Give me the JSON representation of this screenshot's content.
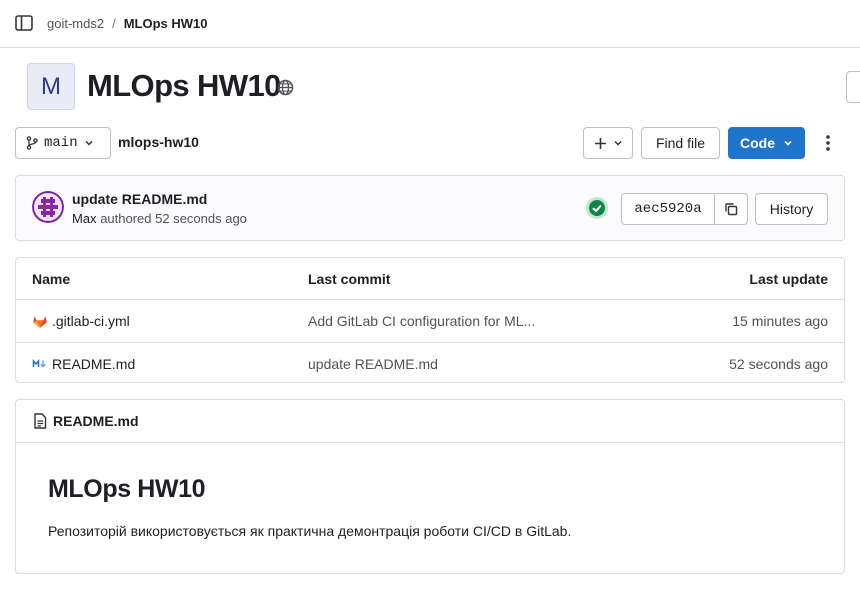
{
  "breadcrumb": {
    "group": "goit-mds2",
    "separator": "/",
    "current": "MLOps HW10"
  },
  "project": {
    "avatar_letter": "M",
    "title": "MLOps HW10",
    "visibility_icon": "globe-icon"
  },
  "toolbar": {
    "branch": "main",
    "path": "mlops-hw10",
    "plus_label": "+",
    "find_file": "Find file",
    "code": "Code"
  },
  "commit": {
    "title": "update README.md",
    "author": "Max",
    "meta_suffix": "authored 52 seconds ago",
    "pipeline_status": "passed",
    "sha": "aec5920a",
    "history": "History"
  },
  "files": {
    "headers": {
      "name": "Name",
      "last_commit": "Last commit",
      "last_update": "Last update"
    },
    "rows": [
      {
        "name": ".gitlab-ci.yml",
        "icon": "gitlab-icon",
        "last_commit": "Add GitLab CI configuration for ML...",
        "last_update": "15 minutes ago"
      },
      {
        "name": "README.md",
        "icon": "markdown-icon",
        "last_commit": "update README.md",
        "last_update": "52 seconds ago"
      }
    ]
  },
  "readme": {
    "filename": "README.md",
    "heading": "MLOps HW10",
    "body": "Репозиторій використовується як практична демонтрація роботи CI/CD в GitLab."
  },
  "colors": {
    "primary": "#1f75cb",
    "success": "#108548",
    "border": "#dcdcde"
  }
}
